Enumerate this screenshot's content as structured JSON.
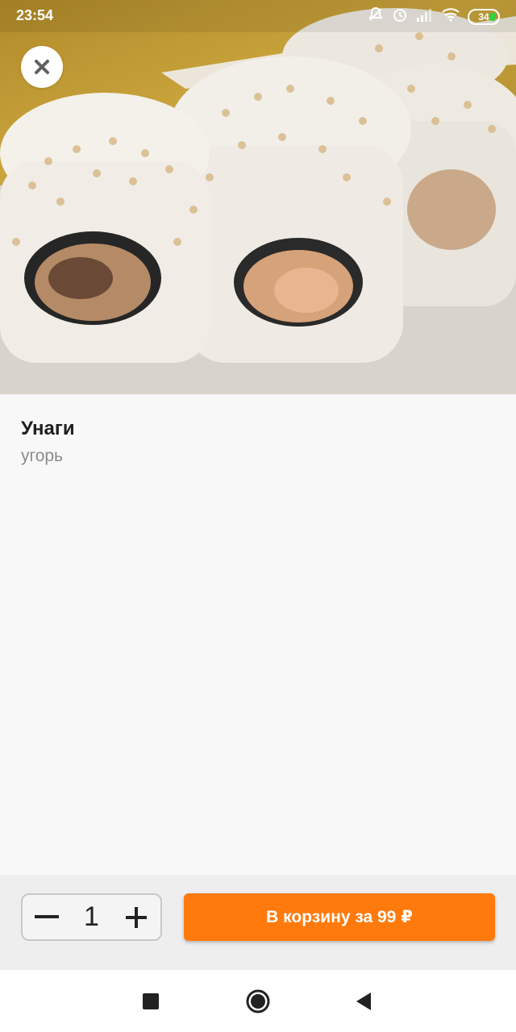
{
  "status_bar": {
    "time": "23:54",
    "battery_level": "34",
    "icons": [
      "muted-bell-icon",
      "alarm-icon",
      "signal-icon",
      "wifi-icon",
      "battery-icon"
    ]
  },
  "hero": {
    "close_icon": "close-icon"
  },
  "product": {
    "name": "Унаги",
    "description": "угорь"
  },
  "order": {
    "quantity": "1",
    "minus_icon": "minus-icon",
    "plus_icon": "plus-icon",
    "add_to_cart_label": "В корзину за 99 ₽"
  },
  "navbar": {
    "icons": [
      "recent-apps-icon",
      "home-icon",
      "back-icon"
    ]
  },
  "colors": {
    "accent": "#ff7a0d",
    "background": "#f8f8f8",
    "action_bar": "#eeeeee"
  }
}
